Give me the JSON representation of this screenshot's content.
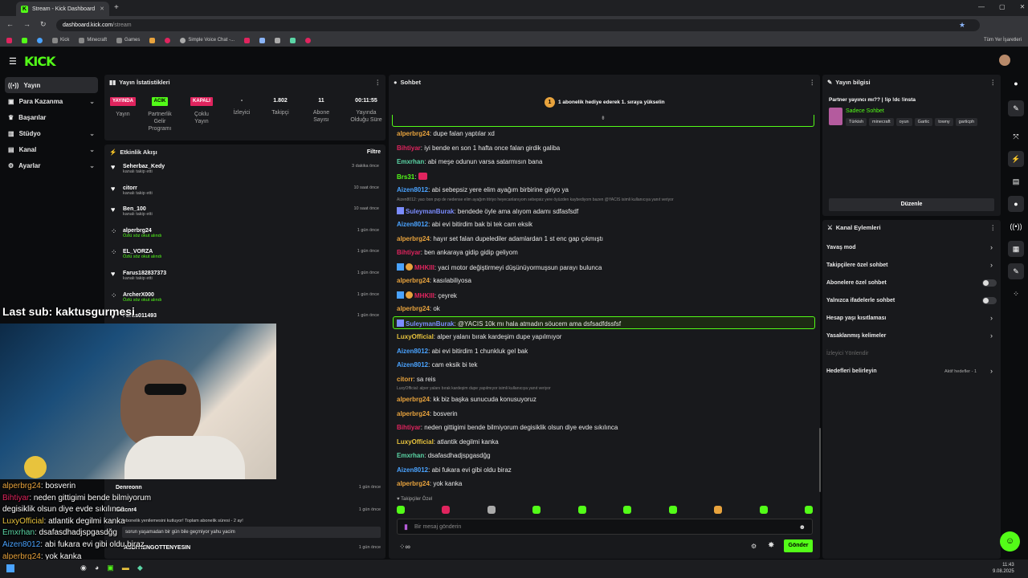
{
  "browser": {
    "tab_title": "Stream - Kick Dashboard",
    "url_host": "dashboard.kick.com",
    "url_path": "/stream",
    "bookmarks": [
      "Kick",
      "Minecraft",
      "Games",
      "Simple Voice Chat -..."
    ],
    "all_bookmarks": "Tüm Yer İşaretleri"
  },
  "sidebar": {
    "items": [
      {
        "label": "Yayın",
        "icon": "broadcast-icon",
        "active": true
      },
      {
        "label": "Para Kazanma",
        "icon": "money-icon"
      },
      {
        "label": "Başarılar",
        "icon": "trophy-icon"
      },
      {
        "label": "Stüdyo",
        "icon": "studio-icon"
      },
      {
        "label": "Kanal",
        "icon": "channel-icon"
      },
      {
        "label": "Ayarlar",
        "icon": "gear-icon"
      }
    ]
  },
  "stats": {
    "title": "Yayın İstatistikleri",
    "items": [
      {
        "badge": "YAYINDA",
        "label": "Yayın",
        "color": "#e0245e"
      },
      {
        "badge": "ACIK",
        "label": "Partnerlik Gelir Programı",
        "color": "#53fc18"
      },
      {
        "badge": "KAPALI",
        "label": "Çoklu Yayın",
        "color": "#e0245e"
      },
      {
        "value": "-",
        "label": "İzleyici"
      },
      {
        "value": "1.802",
        "label": "Takipçi"
      },
      {
        "value": "11",
        "label": "Abone Sayısı"
      },
      {
        "value": "00:11:55",
        "label": "Yayında Olduğu Süre"
      }
    ]
  },
  "activity": {
    "title": "Etkinlik Akışı",
    "filter": "Filtre",
    "events": [
      {
        "name": "Seherbaz_Kedy",
        "sub": "kanalı takip etti",
        "time": "3 dakika önce"
      },
      {
        "name": "citorr",
        "sub": "kanalı takip etti",
        "time": "10 saat önce"
      },
      {
        "name": "Ben_100",
        "sub": "kanalı takip etti",
        "time": "10 saat önce"
      },
      {
        "name": "alperbrg24",
        "sub": "Özlü söz okut alındı",
        "time": "1 gün önce",
        "green": true
      },
      {
        "name": "EL_VORZA",
        "sub": "Özlü söz okut alındı",
        "time": "1 gün önce",
        "green": true
      },
      {
        "name": "Farus182837373",
        "sub": "kanalı takip etti",
        "time": "1 gün önce"
      },
      {
        "name": "ArcherX000",
        "sub": "Özlü söz okut alındı",
        "time": "1 gün önce",
        "green": true
      },
      {
        "name": "Farus011493",
        "sub": "",
        "time": "1 gün önce"
      }
    ],
    "bottom_events": [
      {
        "name": "Denreonn",
        "time": "1 gün önce"
      },
      {
        "name": "Sercnr4",
        "time": "1 gün önce"
      },
      {
        "name": "ASDIYIENGOTTENYESIN",
        "time": "1 gün önce"
      }
    ],
    "resub_text": "abonelik yenilemesini kutluyor! Toplam abonelik süresi - 2 ay!",
    "resub_msg": "sorun yaşamadan bir gün bile geçmiyor yahu yacim"
  },
  "chat": {
    "title": "Sohbet",
    "pinned": "1 abonelik hediye ederek 1. sıraya yükselin",
    "messages": [
      {
        "user": "alperbrg24",
        "text": "dupe falan yaptılar xd",
        "color": "#e8a33d"
      },
      {
        "user": "Bihtiyar",
        "text": "iyi bende en son 1 hafta once falan girdik galiba",
        "color": "#e0245e"
      },
      {
        "user": "Emxrhan",
        "text": "abi meşe odunun varsa satarmısın bana",
        "color": "#5bd6a6"
      },
      {
        "user": "Brs31",
        "text": "",
        "color": "#53fc18",
        "emote": true
      },
      {
        "user": "Aizen8012",
        "text": "abi sebepsiz yere elim ayağım birbirine giriyo ya",
        "color": "#4aa3ff"
      },
      {
        "user": "SuleymanBurak",
        "text": "bendede öyle ama alıyom adamı sdfasfsdf",
        "color": "#7b8cff",
        "reply": "Aizen8012: yacı bon pvp de nedense elim ayağım titriyo heyecanlanıyom sebepsiz yere öyüzden kaybediyom bazen @YACIS isimli kullanıcıya yanıt veriyor"
      },
      {
        "user": "Aizen8012",
        "text": "abi evi bitirdim bak bi tek cam eksik",
        "color": "#4aa3ff"
      },
      {
        "user": "alperbrg24",
        "text": "hayır set falan dupelediler adamlardan 1 st enc gap çıkmıştı",
        "color": "#e8a33d"
      },
      {
        "user": "Bihtiyar",
        "text": "ben ankaraya gidip gidip geliyom",
        "color": "#e0245e"
      },
      {
        "user": "MHKIII",
        "text": "yaci motor değiştirmeyi düşünüyormuşsun parayı bulunca",
        "color": "#e0245e"
      },
      {
        "user": "alperbrg24",
        "text": "kasılabiliyosa",
        "color": "#e8a33d"
      },
      {
        "user": "MHKIII",
        "text": "çeyrek",
        "color": "#e0245e"
      },
      {
        "user": "alperbrg24",
        "text": "ok",
        "color": "#e8a33d"
      },
      {
        "user": "SuleymanBurak",
        "text": "@YACIS 10k mı hala atmadın söucem ama dsfsadfdssfsf",
        "color": "#7b8cff",
        "highlight": true
      },
      {
        "user": "LuxyOfficial",
        "text": "alper yalanı bırak kardeşim dupe yapılmıyor",
        "color": "#e8c33d"
      },
      {
        "user": "Aizen8012",
        "text": "abi evi bitirdim 1 chunkluk gel bak",
        "color": "#4aa3ff"
      },
      {
        "user": "Aizen8012",
        "text": "cam eksik bi tek",
        "color": "#4aa3ff"
      },
      {
        "user": "citorr",
        "text": "sa reis",
        "color": "#e8a33d"
      },
      {
        "user": "alperbrg24",
        "text": "kk biz başka sunucuda konusuyoruz",
        "color": "#e8a33d",
        "reply": "LuxyOfficial: alper yalanı bırak kardeşim dupe yapılmıyor isimli kullanıcıya yanıt veriyor"
      },
      {
        "user": "alperbrg24",
        "text": "bosverin",
        "color": "#e8a33d"
      },
      {
        "user": "Bihtiyar",
        "text": "neden gittigimi bende bilmiyorum degisiklik olsun diye evde sıkılınca",
        "color": "#e0245e"
      },
      {
        "user": "LuxyOfficial",
        "text": "atlantik degilmi kanka",
        "color": "#e8c33d"
      },
      {
        "user": "Emxrhan",
        "text": "dsafasdhadjspgasdğg",
        "color": "#5bd6a6"
      },
      {
        "user": "Aizen8012",
        "text": "abi fukara evi gibi oldu biraz",
        "color": "#4aa3ff"
      },
      {
        "user": "alperbrg24",
        "text": "yok kanka",
        "color": "#e8a33d"
      }
    ],
    "followers_only": "Takipçiler Özel",
    "input_placeholder": "Bir mesaj gönderin",
    "send_label": "Gönder"
  },
  "stream_info": {
    "title": "Yayın bilgisi",
    "stream_title": "Partner yayıncı mı?? | !ip !dc !insta",
    "category": "Sadece Sohbet",
    "tags": [
      "Türkish",
      "minecraft",
      "oyun",
      "Gartic",
      "towny",
      "garticph"
    ],
    "edit": "Düzenle"
  },
  "channel_actions": {
    "title": "Kanal Eylemleri",
    "items": [
      {
        "label": "Yavaş mod",
        "type": "arrow"
      },
      {
        "label": "Takipçilere özel sohbet",
        "type": "arrow"
      },
      {
        "label": "Abonelere özel sohbet",
        "type": "toggle"
      },
      {
        "label": "Yalnızca ifadelerle sohbet",
        "type": "toggle"
      },
      {
        "label": "Hesap yaşı kısıtlaması",
        "type": "arrow"
      },
      {
        "label": "Yasaklanmış kelimeler",
        "type": "arrow"
      },
      {
        "label": "İzleyici Yönlendir",
        "type": "disabled"
      },
      {
        "label": "Hedefleri belirleyin",
        "type": "arrow",
        "extra": "Aktif hedefler - 1"
      }
    ]
  },
  "overlay": {
    "last_sub": "Last sub: kaktusgurmesi",
    "chat": [
      {
        "user": "alperbrg24",
        "text": "bosverin",
        "color": "#e8a33d"
      },
      {
        "user": "Bihtiyar",
        "text": "neden gittigimi bende bilmiyorum",
        "color": "#e0245e"
      },
      {
        "user": "",
        "text": "degisiklik olsun diye evde sıkılınca",
        "color": "#fff"
      },
      {
        "user": "LuxyOfficial",
        "text": "atlantik degilmi kanka",
        "color": "#e8c33d"
      },
      {
        "user": "Emxrhan",
        "text": "dsafasdhadjspgasdğg",
        "color": "#5bd6a6"
      },
      {
        "user": "Aizen8012",
        "text": "abi fukara evi gibi oldu biraz",
        "color": "#4aa3ff"
      },
      {
        "user": "alperbrg24",
        "text": "yok kanka",
        "color": "#e8a33d"
      }
    ]
  },
  "clock": {
    "time": "11:43",
    "date": "9.08.2025"
  },
  "colors": {
    "accent": "#53fc18",
    "panel": "#18191c",
    "bg": "#0b0c0e"
  }
}
